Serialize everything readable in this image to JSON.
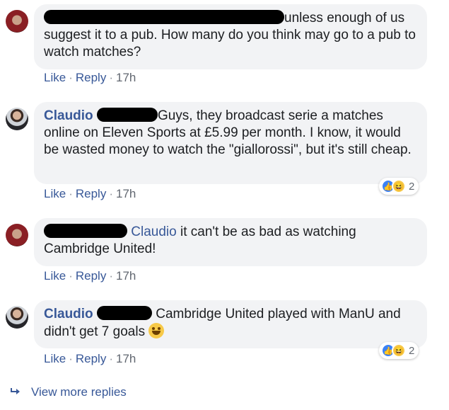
{
  "comments": [
    {
      "author": "",
      "text": "unless enough of us suggest it to a pub. How many do you think may go to a pub to watch matches?",
      "actions": {
        "like": "Like",
        "reply": "Reply",
        "time": "17h"
      }
    },
    {
      "author": "Claudio",
      "text": "Guys, they broadcast serie a matches online on Eleven Sports at £5.99 per month. I know, it would be wasted money to watch the \"giallorossi\", but it's still cheap.",
      "actions": {
        "like": "Like",
        "reply": "Reply",
        "time": "17h"
      },
      "reactions": {
        "count": "2"
      }
    },
    {
      "author": "",
      "mention": "Claudio",
      "text": "it can't be as bad as watching Cambridge United!",
      "actions": {
        "like": "Like",
        "reply": "Reply",
        "time": "17h"
      }
    },
    {
      "author": "Claudio",
      "text": "Cambridge United played with ManU and didn't get 7 goals",
      "actions": {
        "like": "Like",
        "reply": "Reply",
        "time": "17h"
      },
      "reactions": {
        "count": "2"
      }
    }
  ],
  "view_more": "View more replies",
  "icons": {
    "like": "thumbs-up-icon",
    "haha": "laughing-face-icon",
    "reply_arrow": "reply-arrow-icon",
    "smile": "grinning-face-icon"
  },
  "colors": {
    "link": "#385898",
    "bubble": "#f2f3f5",
    "like_blue": "#3b82f6",
    "emoji_yellow": "#f7c948"
  }
}
